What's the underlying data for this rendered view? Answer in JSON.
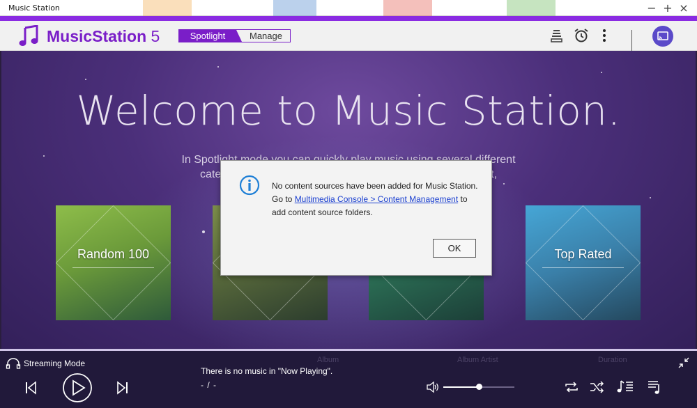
{
  "window": {
    "title": "Music Station",
    "controls": {
      "minimize": "−",
      "maximize": "+",
      "close": "×"
    }
  },
  "header": {
    "app_name_bold": "MusicStation",
    "app_version": " 5",
    "tabs": [
      {
        "label": "Spotlight",
        "active": true
      },
      {
        "label": "Manage",
        "active": false
      }
    ],
    "icons": [
      "queue-stack-icon",
      "alarm-clock-icon",
      "more-vertical-icon",
      "cast-icon"
    ]
  },
  "main": {
    "welcome": "Welcome to Music Station.",
    "intro_line1": "In Spotlight mode you can quickly play music using several different",
    "intro_line2": "categ                                                                                 ght,",
    "tiles": [
      {
        "label": "Random 100",
        "color": "#7fa93a"
      },
      {
        "label": "",
        "color": "#6d7a45"
      },
      {
        "label": "",
        "color": "#2f6f55"
      },
      {
        "label": "Top Rated",
        "color": "#3b8fb8"
      }
    ]
  },
  "dialog": {
    "line1": "No content sources have been added for Music Station.",
    "line2_prefix": "Go to ",
    "link_text": "Multimedia Console > Content Management",
    "line2_suffix": " to",
    "line3": "add content source folders.",
    "ok_label": "OK"
  },
  "player": {
    "stream_mode": "Streaming Mode",
    "now_playing": "There is no music in \"Now Playing\".",
    "time": "- / -",
    "volume": 0.5,
    "ghost_headers": [
      "Album",
      "Album Artist",
      "Duration"
    ],
    "accent": "#ffffff"
  }
}
